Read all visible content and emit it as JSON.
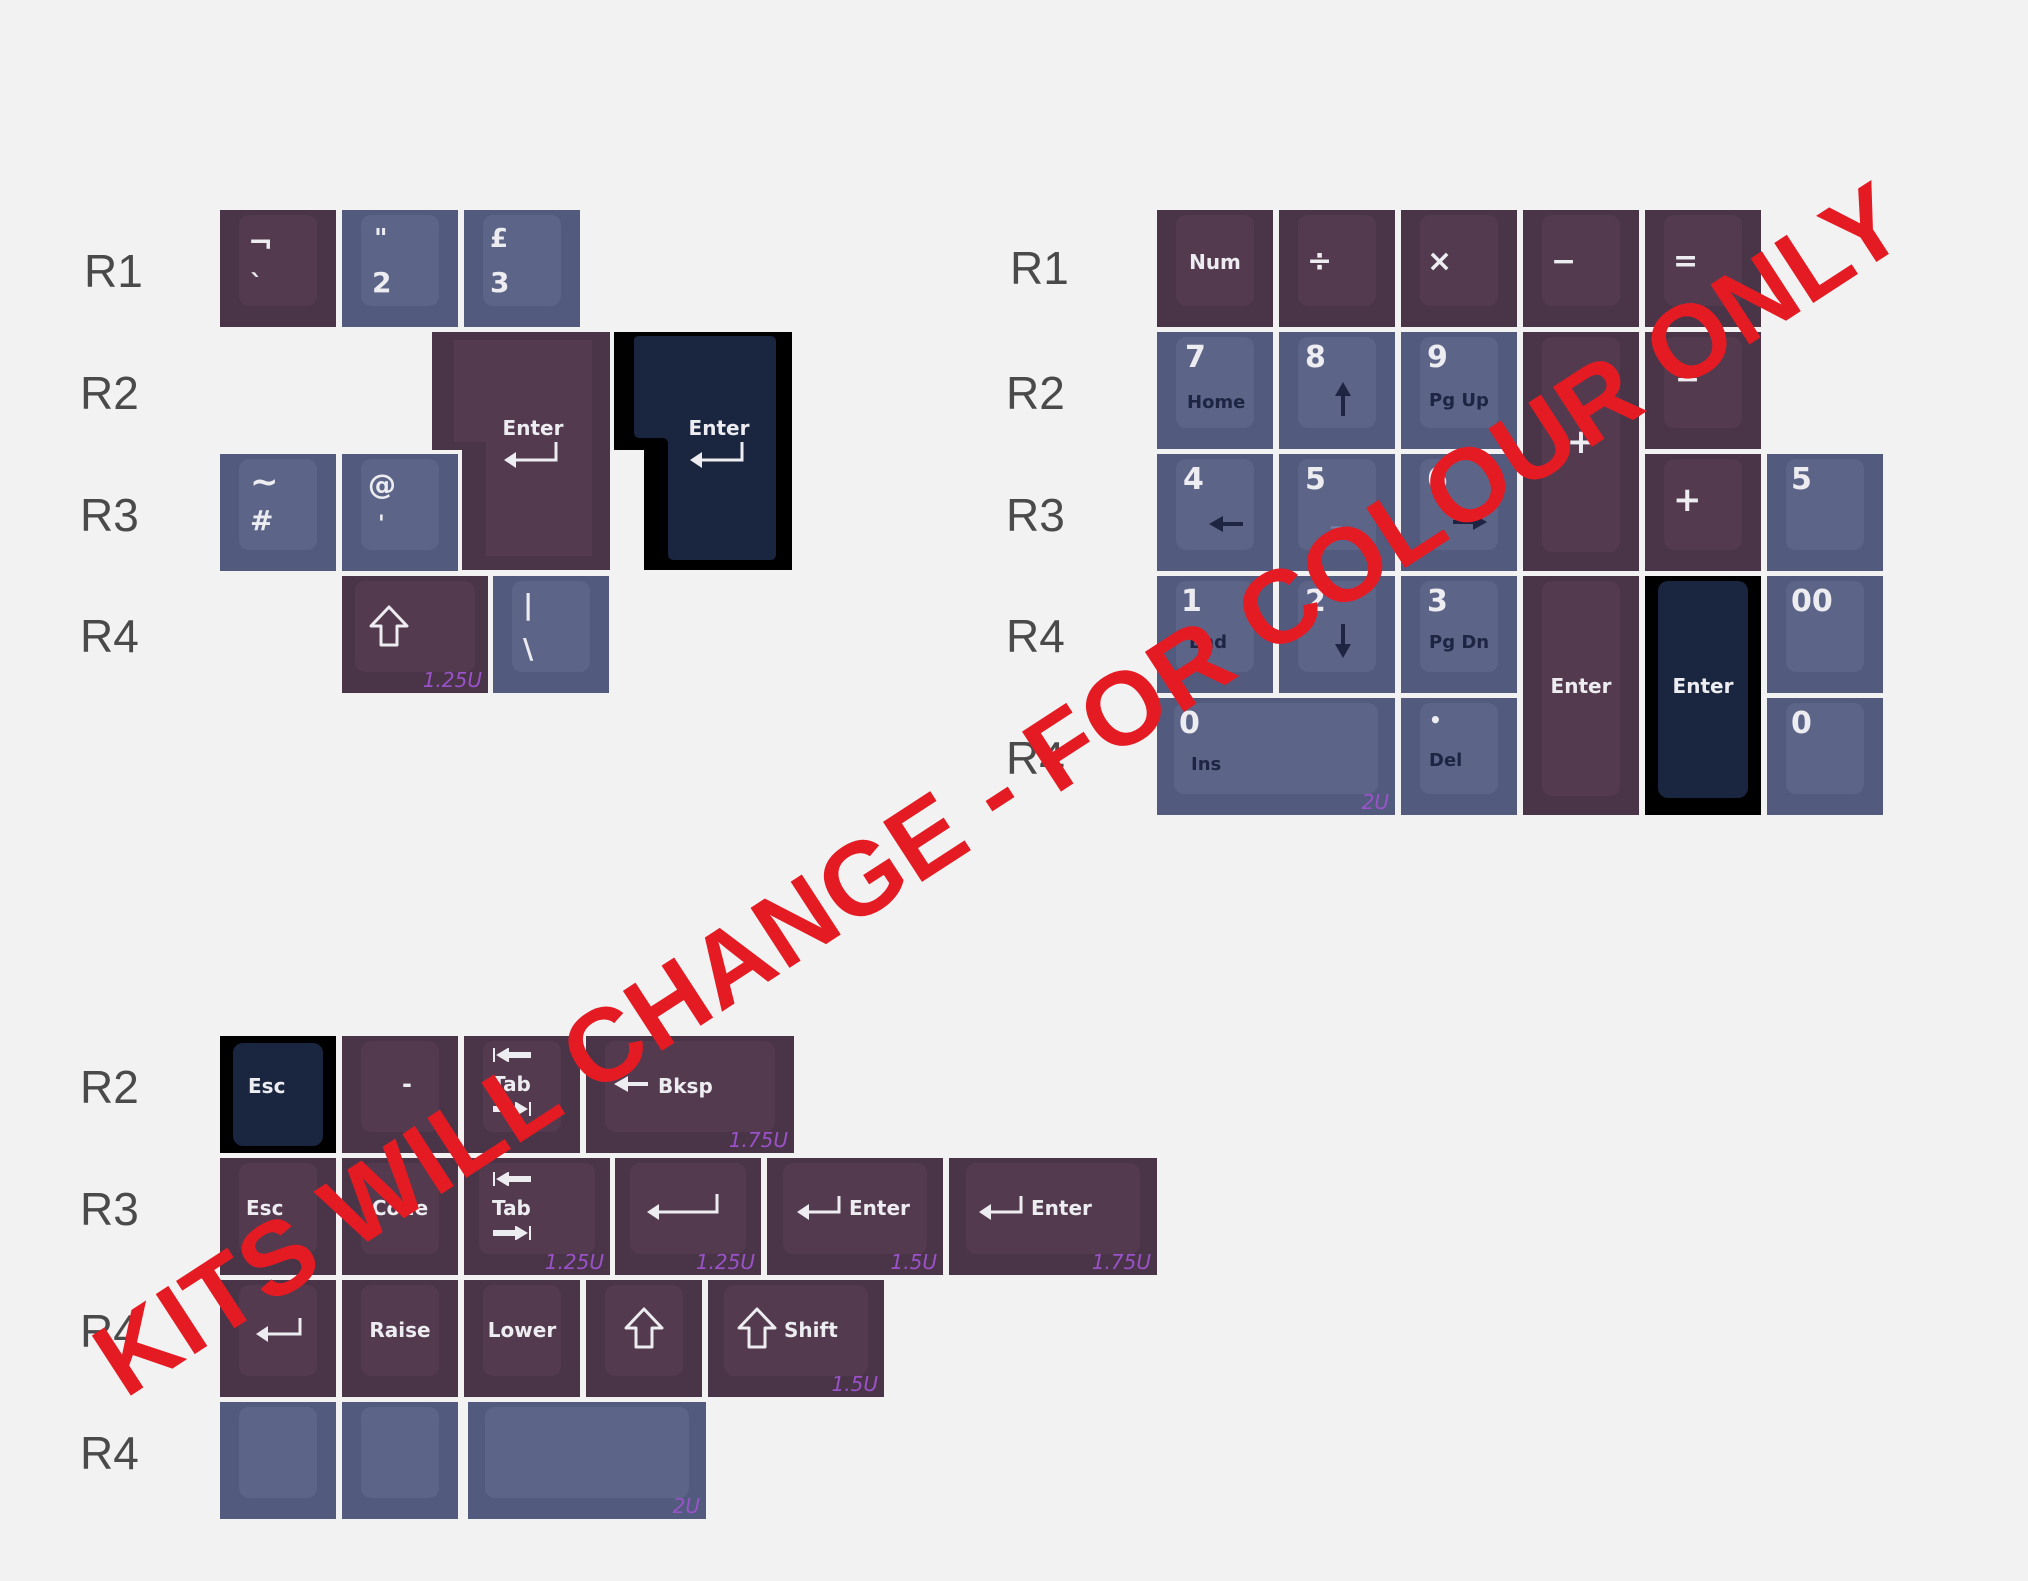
{
  "watermark": "KITS WILL CHANGE - FOR COLOUR ONLY",
  "colors": {
    "plum": "#4a3447",
    "slate": "#525a7e",
    "navy": "#1a2640",
    "watermark": "#e51b24",
    "size_label": "#9a52c9"
  },
  "groups": [
    {
      "name": "iso-extras",
      "row_labels": [
        "R1",
        "R2",
        "R3",
        "R4"
      ]
    },
    {
      "name": "numpad",
      "row_labels": [
        "R1",
        "R2",
        "R3",
        "R4",
        "R4"
      ]
    },
    {
      "name": "ortho-mods",
      "row_labels": [
        "R2",
        "R3",
        "R4",
        "R4"
      ]
    }
  ],
  "keys": [
    {
      "id": "k_notsign",
      "color": "plum",
      "group": 0,
      "legends": [
        "¬",
        "`"
      ]
    },
    {
      "id": "k_quote2",
      "color": "slate",
      "group": 0,
      "legends": [
        "\"",
        "2"
      ]
    },
    {
      "id": "k_pound3",
      "color": "slate",
      "group": 0,
      "legends": [
        "£",
        "3"
      ]
    },
    {
      "id": "k_iso_enter_plum",
      "color": "plum",
      "group": 0,
      "legends": [
        "Enter"
      ],
      "icon": "enter-arrow-icon"
    },
    {
      "id": "k_iso_enter_navy",
      "color": "navy",
      "group": 0,
      "legends": [
        "Enter"
      ],
      "icon": "enter-arrow-icon"
    },
    {
      "id": "k_tilde_hash",
      "color": "slate",
      "group": 0,
      "legends": [
        "~",
        "#"
      ]
    },
    {
      "id": "k_at_apos",
      "color": "slate",
      "group": 0,
      "legends": [
        "@",
        "'"
      ]
    },
    {
      "id": "k_shift_125",
      "color": "plum",
      "group": 0,
      "legends": [],
      "icon": "shift-arrow-icon",
      "size": "1.25U"
    },
    {
      "id": "k_pipe_backslash",
      "color": "slate",
      "group": 0,
      "legends": [
        "|",
        "\\"
      ]
    },
    {
      "id": "k_num",
      "color": "plum",
      "group": 1,
      "legends": [
        "Num"
      ]
    },
    {
      "id": "k_divide",
      "color": "plum",
      "group": 1,
      "legends": [
        "÷"
      ]
    },
    {
      "id": "k_multiply",
      "color": "plum",
      "group": 1,
      "legends": [
        "×"
      ]
    },
    {
      "id": "k_minus",
      "color": "plum",
      "group": 1,
      "legends": [
        "−"
      ]
    },
    {
      "id": "k_equals",
      "color": "plum",
      "group": 1,
      "legends": [
        "="
      ]
    },
    {
      "id": "k_7",
      "color": "slate",
      "group": 1,
      "legends": [
        "7",
        "Home"
      ]
    },
    {
      "id": "k_8",
      "color": "slate",
      "group": 1,
      "legends": [
        "8"
      ],
      "icon": "arrow-up-icon"
    },
    {
      "id": "k_9",
      "color": "slate",
      "group": 1,
      "legends": [
        "9",
        "Pg Up"
      ]
    },
    {
      "id": "k_plus_tall",
      "color": "plum",
      "group": 1,
      "legends": [
        "+"
      ]
    },
    {
      "id": "k_minus_r2",
      "color": "plum",
      "group": 1,
      "legends": [
        "−"
      ]
    },
    {
      "id": "k_4",
      "color": "slate",
      "group": 1,
      "legends": [
        "4"
      ],
      "icon": "arrow-left-icon"
    },
    {
      "id": "k_5",
      "color": "slate",
      "group": 1,
      "legends": [
        "5",
        "_"
      ]
    },
    {
      "id": "k_6",
      "color": "slate",
      "group": 1,
      "legends": [
        "6"
      ],
      "icon": "arrow-right-icon"
    },
    {
      "id": "k_plus_r3",
      "color": "plum",
      "group": 1,
      "legends": [
        "+"
      ]
    },
    {
      "id": "k_5_extra",
      "color": "slate",
      "group": 1,
      "legends": [
        "5"
      ]
    },
    {
      "id": "k_1",
      "color": "slate",
      "group": 1,
      "legends": [
        "1",
        "End"
      ]
    },
    {
      "id": "k_2",
      "color": "slate",
      "group": 1,
      "legends": [
        "2"
      ],
      "icon": "arrow-down-icon"
    },
    {
      "id": "k_3",
      "color": "slate",
      "group": 1,
      "legends": [
        "3",
        "Pg Dn"
      ]
    },
    {
      "id": "k_enter_tall_plum",
      "color": "plum",
      "group": 1,
      "legends": [
        "Enter"
      ]
    },
    {
      "id": "k_enter_tall_navy",
      "color": "navy",
      "group": 1,
      "legends": [
        "Enter"
      ]
    },
    {
      "id": "k_00",
      "color": "slate",
      "group": 1,
      "legends": [
        "00"
      ]
    },
    {
      "id": "k_0_2u",
      "color": "slate",
      "group": 1,
      "legends": [
        "0",
        "Ins"
      ],
      "size": "2U"
    },
    {
      "id": "k_del",
      "color": "slate",
      "group": 1,
      "legends": [
        "•",
        "Del"
      ]
    },
    {
      "id": "k_0_extra",
      "color": "slate",
      "group": 1,
      "legends": [
        "0"
      ]
    },
    {
      "id": "k_esc_navy",
      "color": "navy",
      "group": 2,
      "legends": [
        "Esc"
      ]
    },
    {
      "id": "k_dash_hidden",
      "color": "plum",
      "group": 2,
      "legends": [
        "-"
      ]
    },
    {
      "id": "k_tab_1u",
      "color": "plum",
      "group": 2,
      "legends": [
        "Tab"
      ],
      "icon": "tab-arrows-icon"
    },
    {
      "id": "k_bksp_175",
      "color": "plum",
      "group": 2,
      "legends": [
        "Bksp"
      ],
      "icon": "arrow-left-icon",
      "size": "1.75U"
    },
    {
      "id": "k_esc_plum",
      "color": "plum",
      "group": 2,
      "legends": [
        "Esc"
      ]
    },
    {
      "id": "k_code",
      "color": "plum",
      "group": 2,
      "legends": [
        "Code"
      ]
    },
    {
      "id": "k_tab_125",
      "color": "plum",
      "group": 2,
      "legends": [
        "Tab"
      ],
      "icon": "tab-arrows-icon",
      "size": "1.25U"
    },
    {
      "id": "k_enter_icon_125",
      "color": "plum",
      "group": 2,
      "legends": [],
      "icon": "enter-arrow-icon",
      "size": "1.25U"
    },
    {
      "id": "k_enter_15",
      "color": "plum",
      "group": 2,
      "legends": [
        "Enter"
      ],
      "icon": "enter-arrow-icon",
      "size": "1.5U"
    },
    {
      "id": "k_enter_175",
      "color": "plum",
      "group": 2,
      "legends": [
        "Enter"
      ],
      "icon": "enter-arrow-icon",
      "size": "1.75U"
    },
    {
      "id": "k_enter_icon_1u",
      "color": "plum",
      "group": 2,
      "legends": [],
      "icon": "enter-arrow-icon"
    },
    {
      "id": "k_raise",
      "color": "plum",
      "group": 2,
      "legends": [
        "Raise"
      ]
    },
    {
      "id": "k_lower",
      "color": "plum",
      "group": 2,
      "legends": [
        "Lower"
      ]
    },
    {
      "id": "k_shift_icon_1u",
      "color": "plum",
      "group": 2,
      "legends": [],
      "icon": "shift-arrow-icon"
    },
    {
      "id": "k_shift_15",
      "color": "plum",
      "group": 2,
      "legends": [
        "Shift"
      ],
      "icon": "shift-arrow-icon",
      "size": "1.5U"
    },
    {
      "id": "k_blank_1",
      "color": "slate",
      "group": 2,
      "legends": []
    },
    {
      "id": "k_blank_2",
      "color": "slate",
      "group": 2,
      "legends": []
    },
    {
      "id": "k_space_2u",
      "color": "slate",
      "group": 2,
      "legends": [],
      "size": "2U"
    }
  ]
}
